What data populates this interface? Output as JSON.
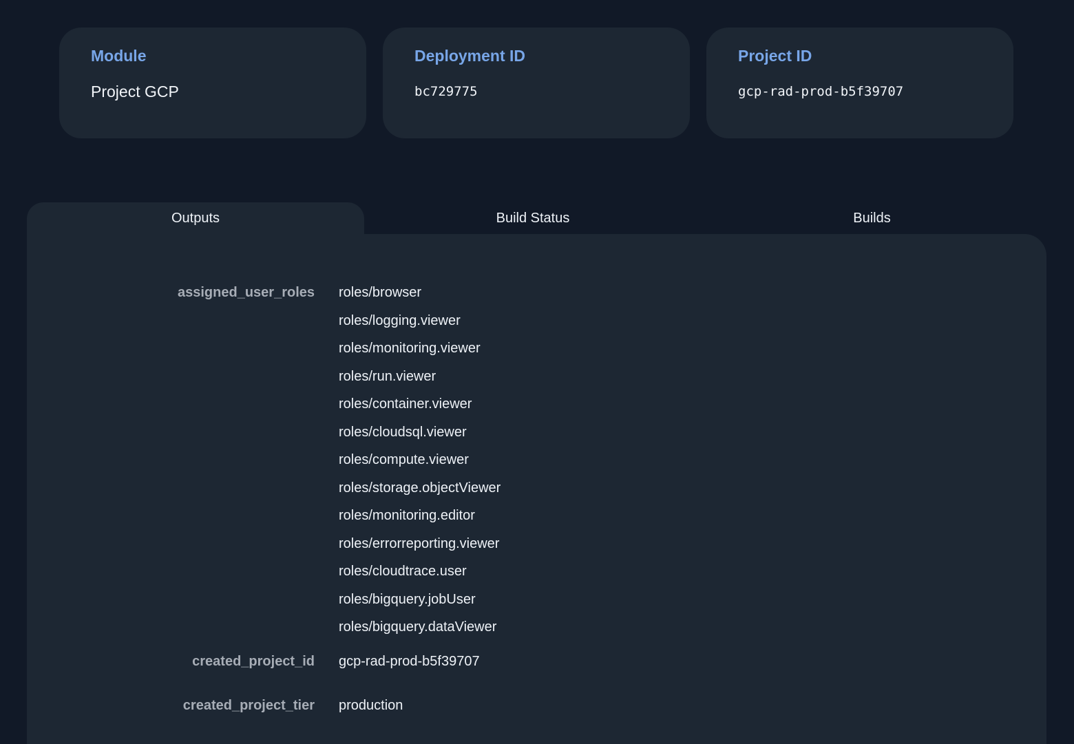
{
  "cards": [
    {
      "label": "Module",
      "value": "Project GCP"
    },
    {
      "label": "Deployment ID",
      "value": "bc729775"
    },
    {
      "label": "Project ID",
      "value": "gcp-rad-prod-b5f39707"
    }
  ],
  "tabs": [
    "Outputs",
    "Build Status",
    "Builds"
  ],
  "outputs": {
    "assigned_user_roles": {
      "key": "assigned_user_roles",
      "values": [
        "roles/browser",
        "roles/logging.viewer",
        "roles/monitoring.viewer",
        "roles/run.viewer",
        "roles/container.viewer",
        "roles/cloudsql.viewer",
        "roles/compute.viewer",
        "roles/storage.objectViewer",
        "roles/monitoring.editor",
        "roles/errorreporting.viewer",
        "roles/cloudtrace.user",
        "roles/bigquery.jobUser",
        "roles/bigquery.dataViewer"
      ]
    },
    "created_project_id": {
      "key": "created_project_id",
      "value": "gcp-rad-prod-b5f39707"
    },
    "created_project_tier": {
      "key": "created_project_tier",
      "value": "production"
    }
  }
}
